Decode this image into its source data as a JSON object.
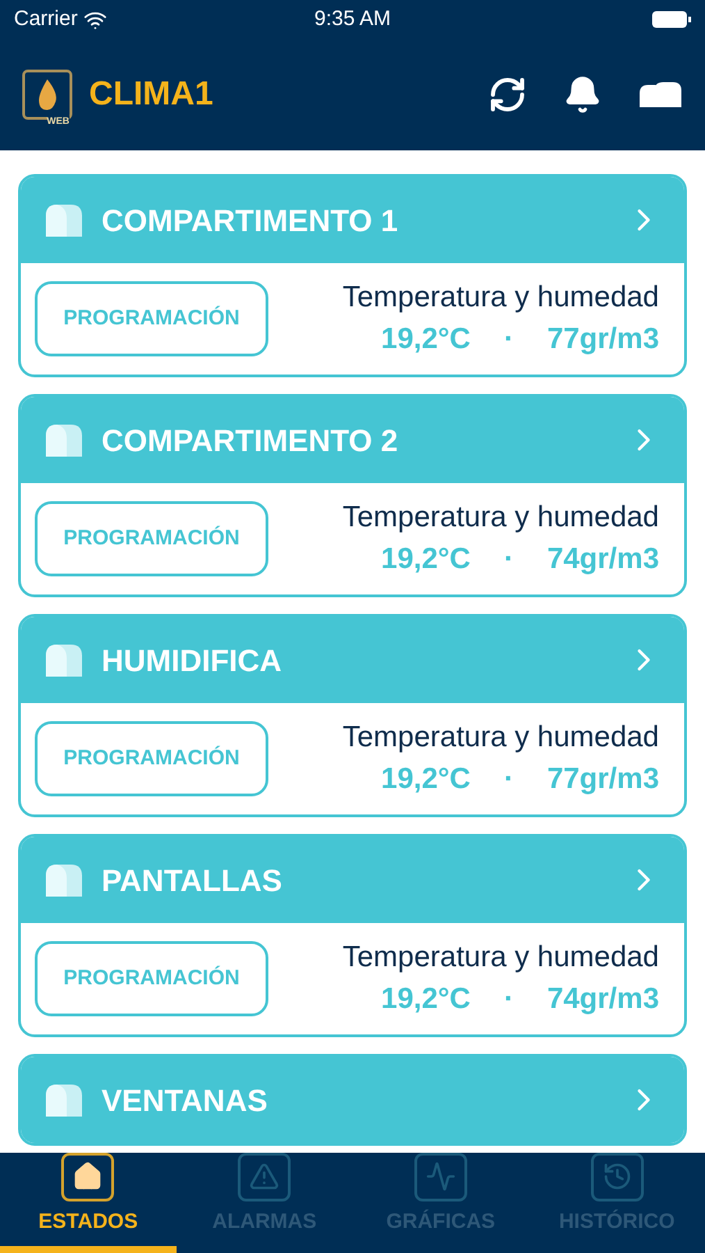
{
  "status_bar": {
    "carrier": "Carrier",
    "time": "9:35 AM"
  },
  "header": {
    "logo_text": "WEB",
    "title": "CLIMA1"
  },
  "compartments": [
    {
      "name": "COMPARTIMENTO 1",
      "button": "PROGRAMACIÓN",
      "label": "Temperatura y humedad",
      "temperature": "19,2°C",
      "separator": "·",
      "humidity": "77gr/m3"
    },
    {
      "name": "COMPARTIMENTO 2",
      "button": "PROGRAMACIÓN",
      "label": "Temperatura y humedad",
      "temperature": "19,2°C",
      "separator": "·",
      "humidity": "74gr/m3"
    },
    {
      "name": "HUMIDIFICA",
      "button": "PROGRAMACIÓN",
      "label": "Temperatura y humedad",
      "temperature": "19,2°C",
      "separator": "·",
      "humidity": "77gr/m3"
    },
    {
      "name": "PANTALLAS",
      "button": "PROGRAMACIÓN",
      "label": "Temperatura y humedad",
      "temperature": "19,2°C",
      "separator": "·",
      "humidity": "74gr/m3"
    },
    {
      "name": "VENTANAS"
    }
  ],
  "tabs": [
    {
      "kind": "home",
      "label": "ESTADOS",
      "selected": true
    },
    {
      "kind": "alarm",
      "label": "ALARMAS",
      "selected": false
    },
    {
      "kind": "chart",
      "label": "GRÁFICAS",
      "selected": false
    },
    {
      "kind": "history",
      "label": "HISTÓRICO",
      "selected": false
    }
  ]
}
